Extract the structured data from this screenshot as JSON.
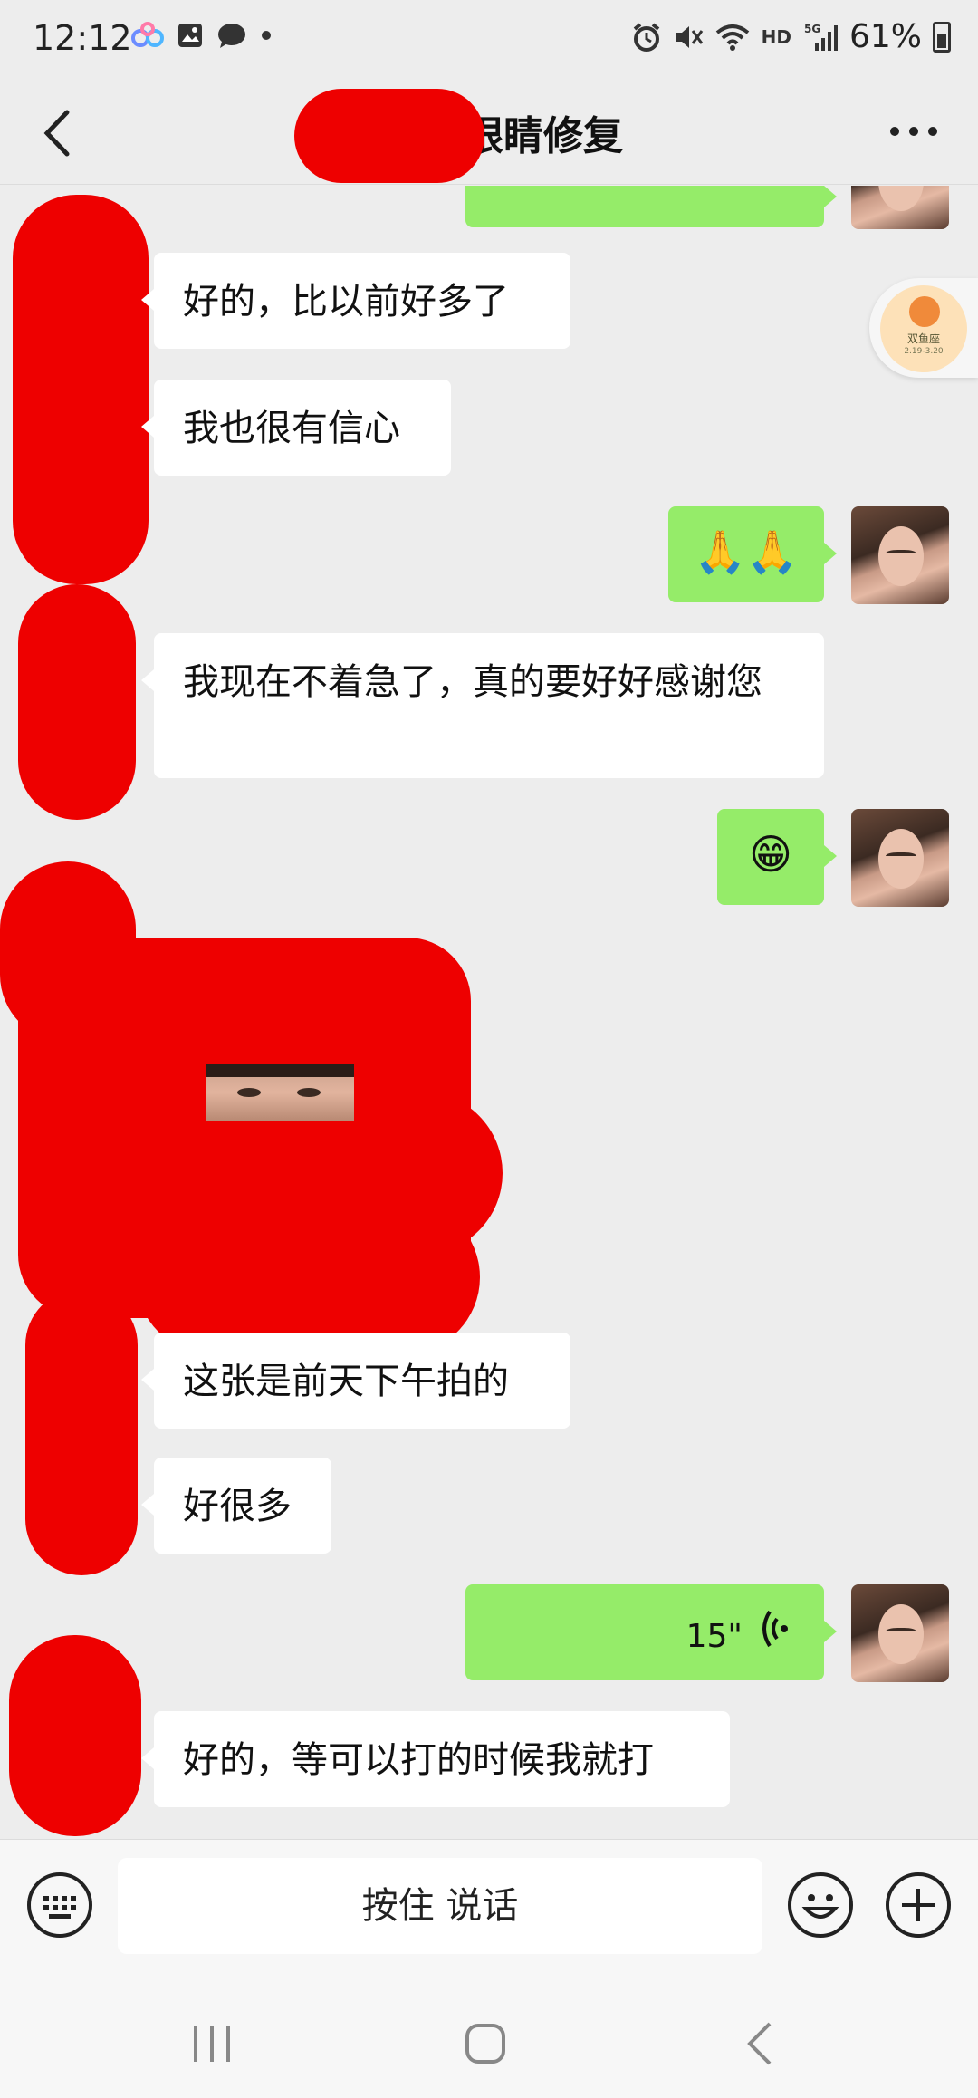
{
  "status_bar": {
    "time": "12:12",
    "battery": "61%",
    "network": "HD",
    "left_icons": [
      "meta-app-icon",
      "gallery-icon",
      "message-icon",
      "dot-icon"
    ],
    "right_icons": [
      "alarm-icon",
      "mute-icon",
      "wifi-icon",
      "signal-5g-icon",
      "battery-icon"
    ]
  },
  "header": {
    "title": "眼睛修复",
    "back_icon": "chevron-left-icon",
    "more_icon": "more-dots-icon"
  },
  "float_badge": {
    "title": "双鱼座",
    "date": "2.19-3.20"
  },
  "messages": [
    {
      "side": "out",
      "type": "voice",
      "text": ""
    },
    {
      "side": "in",
      "type": "text",
      "text": "好的，比以前好多了"
    },
    {
      "side": "in",
      "type": "text",
      "text": "我也很有信心"
    },
    {
      "side": "out",
      "type": "emoji",
      "text": "🙏🙏"
    },
    {
      "side": "in",
      "type": "text",
      "text": "我现在不着急了，真的要好好感谢您"
    },
    {
      "side": "out",
      "type": "emoji",
      "text": "😁"
    },
    {
      "side": "in",
      "type": "image",
      "text": ""
    },
    {
      "side": "in",
      "type": "text",
      "text": "这张是前天下午拍的"
    },
    {
      "side": "in",
      "type": "text",
      "text": "好很多"
    },
    {
      "side": "out",
      "type": "voice",
      "text": "15\""
    },
    {
      "side": "in",
      "type": "text",
      "text": "好的，等可以打的时候我就打"
    }
  ],
  "input_bar": {
    "hold_to_talk": "按住 说话",
    "keyboard_icon": "keyboard-icon",
    "emoji_icon": "smiley-icon",
    "plus_icon": "plus-icon"
  },
  "nav_bar": {
    "recents_icon": "recents-icon",
    "home_icon": "home-icon",
    "back_icon": "back-icon"
  },
  "colors": {
    "background": "#ededed",
    "bubble_out": "#95ec69",
    "bubble_in": "#ffffff",
    "redaction": "#ee0000"
  }
}
